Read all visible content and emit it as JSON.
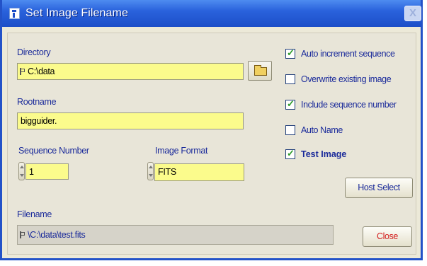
{
  "window": {
    "title": "Set Image Filename",
    "close_glyph": "X"
  },
  "directory": {
    "label": "Directory",
    "value": "C:\\data",
    "browse_icon": "folder-icon"
  },
  "rootname": {
    "label": "Rootname",
    "value": "bigguider."
  },
  "sequence_number": {
    "label": "Sequence Number",
    "value": "1"
  },
  "image_format": {
    "label": "Image Format",
    "value": "FITS"
  },
  "filename": {
    "label": "Filename",
    "value": "\\C:\\data\\test.fits"
  },
  "options": [
    {
      "label": "Auto increment sequence",
      "checked": true
    },
    {
      "label": "Overwrite existing image",
      "checked": false
    },
    {
      "label": "Include sequence number",
      "checked": true
    },
    {
      "label": "Auto Name",
      "checked": false
    },
    {
      "label": "Test Image",
      "checked": true
    }
  ],
  "buttons": {
    "host_select": "Host Select",
    "close": "Close"
  },
  "colors": {
    "field_yellow": "#fbfb8c",
    "label_blue": "#1a2a9a",
    "close_text": "#d42020",
    "check_green": "#2a9a28"
  }
}
